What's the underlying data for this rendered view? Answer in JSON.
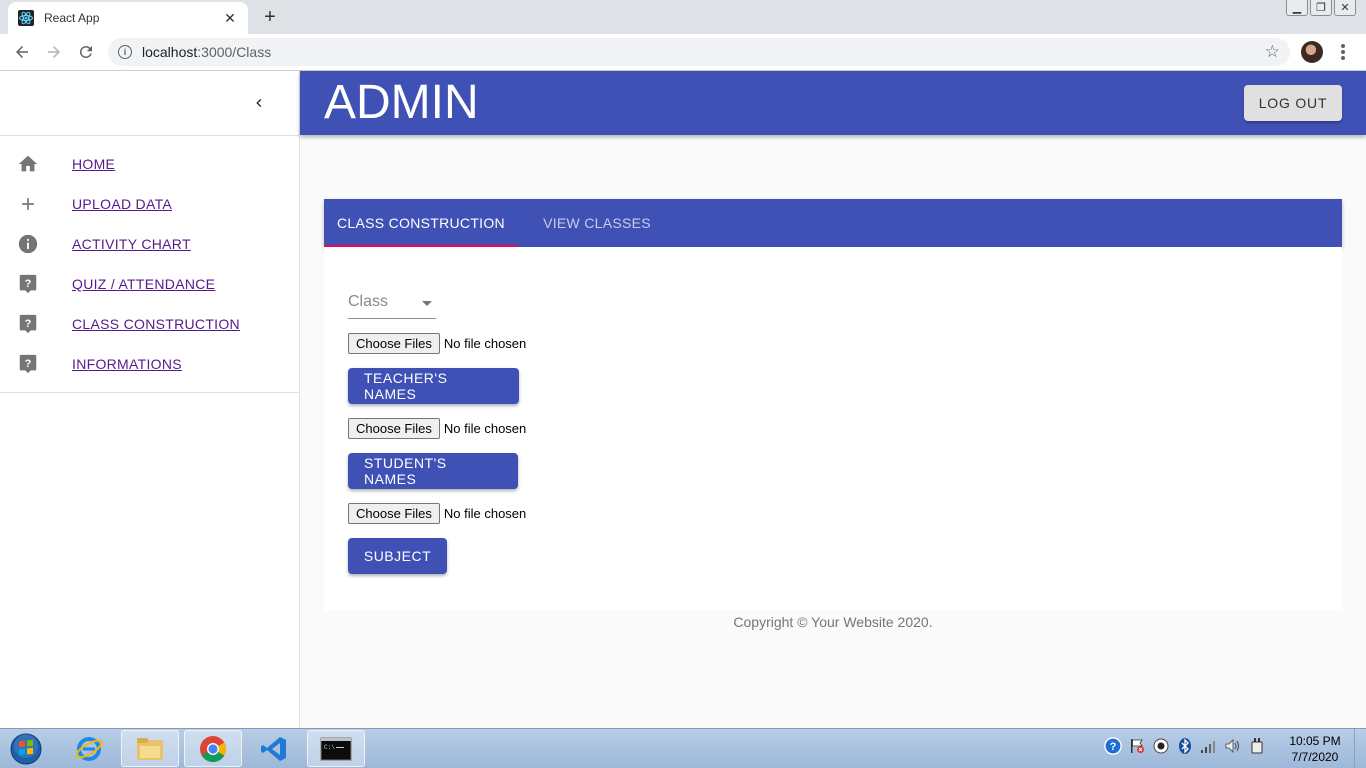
{
  "browser": {
    "tab_title": "React App",
    "url_host": "localhost",
    "url_rest": ":3000/Class"
  },
  "sidebar": {
    "items": [
      {
        "label": "HOME",
        "icon": "home-icon"
      },
      {
        "label": "UPLOAD DATA",
        "icon": "plus-icon"
      },
      {
        "label": "ACTIVITY CHART",
        "icon": "info-icon"
      },
      {
        "label": "QUIZ / ATTENDANCE",
        "icon": "help-icon"
      },
      {
        "label": "CLASS CONSTRUCTION",
        "icon": "help-icon"
      },
      {
        "label": "INFORMATIONS",
        "icon": "help-icon"
      }
    ]
  },
  "header": {
    "title": "ADMIN",
    "logout_label": "LOG OUT"
  },
  "tabs": {
    "items": [
      {
        "label": "CLASS CONSTRUCTION",
        "active": true
      },
      {
        "label": "VIEW CLASSES",
        "active": false
      }
    ]
  },
  "form": {
    "class_select_label": "Class",
    "file_button_label": "Choose Files",
    "file_status": "No file chosen",
    "buttons": {
      "teachers": "TEACHER'S NAMES",
      "students": "STUDENT'S NAMES",
      "subject": "SUBJECT"
    }
  },
  "footer": {
    "copyright": "Copyright © Your Website 2020."
  },
  "taskbar": {
    "time": "10:05 PM",
    "date": "7/7/2020"
  },
  "colors": {
    "primary": "#3f51b5",
    "tab_indicator": "#f50057",
    "link": "#551a8b"
  }
}
